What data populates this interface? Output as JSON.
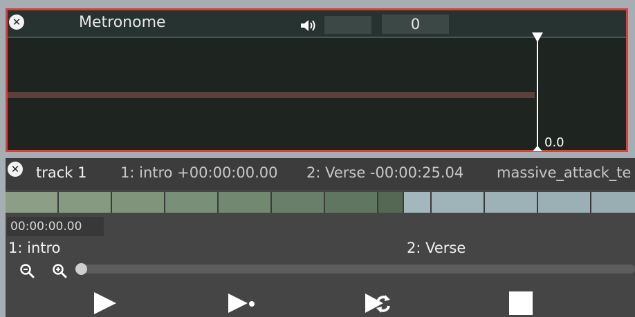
{
  "metronome": {
    "title": "Metronome",
    "value": "0",
    "playhead_time": "0.0",
    "icons": {
      "close": "close-icon",
      "volume": "speaker-icon"
    },
    "colors": {
      "border": "#d9403a",
      "bar": "#5b403c"
    }
  },
  "track": {
    "name": "track 1",
    "markers": [
      "1: intro +00:00:00.00",
      "2: Verse -00:00:25.04",
      "massive_attack_te"
    ],
    "time": "00:00:00.00",
    "sections": [
      "1: intro",
      "2: Verse"
    ],
    "icons": {
      "zoom_out": "zoom-out-icon",
      "zoom_in": "zoom-in-icon",
      "play": "play-icon",
      "play_from": "play-from-cursor-icon",
      "loop": "loop-icon",
      "stop": "stop-icon"
    },
    "zoom_level": 0
  }
}
